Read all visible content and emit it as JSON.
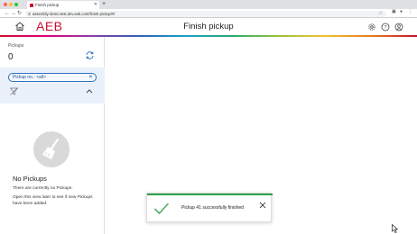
{
  "browser": {
    "tab_title": "Finish pickup",
    "url": "assembly-demo.test.dev.aeb.com/finish-pickup/#/"
  },
  "app": {
    "logo": "AEB",
    "title": "Finish pickup"
  },
  "left_panel": {
    "label": "Pickups",
    "count": "0",
    "filter_chip": "Pickup no.: <all>",
    "empty_title": "No Pickups",
    "empty_text_1": "There are currently no Pickups.",
    "empty_text_2": "Open this view later to see if new Pickups have been added."
  },
  "toast": {
    "message": "Pickup 41 successfully finished",
    "status": "success"
  },
  "colors": {
    "brand_red": "#c8102e",
    "chip_blue": "#2f6fbf",
    "success_green": "#2aa14a"
  }
}
